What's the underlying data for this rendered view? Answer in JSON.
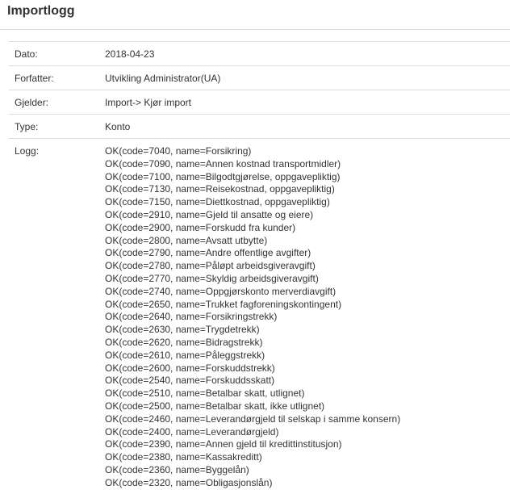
{
  "page": {
    "title": "Importlogg"
  },
  "details": {
    "date_label": "Dato:",
    "date_value": "2018-04-23",
    "author_label": "Forfatter:",
    "author_value": "Utvikling Administrator(UA)",
    "concerns_label": "Gjelder:",
    "concerns_value": "Import-> Kjør import",
    "type_label": "Type:",
    "type_value": "Konto",
    "log_label": "Logg:"
  },
  "log": [
    "OK(code=7040, name=Forsikring)",
    "OK(code=7090, name=Annen kostnad transportmidler)",
    "OK(code=7100, name=Bilgodtgjørelse, oppgavepliktig)",
    "OK(code=7130, name=Reisekostnad, oppgavepliktig)",
    "OK(code=7150, name=Diettkostnad, oppgavepliktig)",
    "OK(code=2910, name=Gjeld til ansatte og eiere)",
    "OK(code=2900, name=Forskudd fra kunder)",
    "OK(code=2800, name=Avsatt utbytte)",
    "OK(code=2790, name=Andre offentlige avgifter)",
    "OK(code=2780, name=Påløpt arbeidsgiveravgift)",
    "OK(code=2770, name=Skyldig arbeidsgiveravgift)",
    "OK(code=2740, name=Oppgjørskonto merverdiavgift)",
    "OK(code=2650, name=Trukket fagforeningskontingent)",
    "OK(code=2640, name=Forsikringstrekk)",
    "OK(code=2630, name=Trygdetrekk)",
    "OK(code=2620, name=Bidragstrekk)",
    "OK(code=2610, name=Påleggstrekk)",
    "OK(code=2600, name=Forskuddstrekk)",
    "OK(code=2540, name=Forskuddsskatt)",
    "OK(code=2510, name=Betalbar skatt, utlignet)",
    "OK(code=2500, name=Betalbar skatt, ikke utlignet)",
    "OK(code=2460, name=Leverandørgjeld til selskap i samme konsern)",
    "OK(code=2400, name=Leverandørgjeld)",
    "OK(code=2390, name=Annen gjeld til kredittinstitusjon)",
    "OK(code=2380, name=Kassakreditt)",
    "OK(code=2360, name=Byggelån)",
    "OK(code=2320, name=Obligasjonslån)"
  ]
}
